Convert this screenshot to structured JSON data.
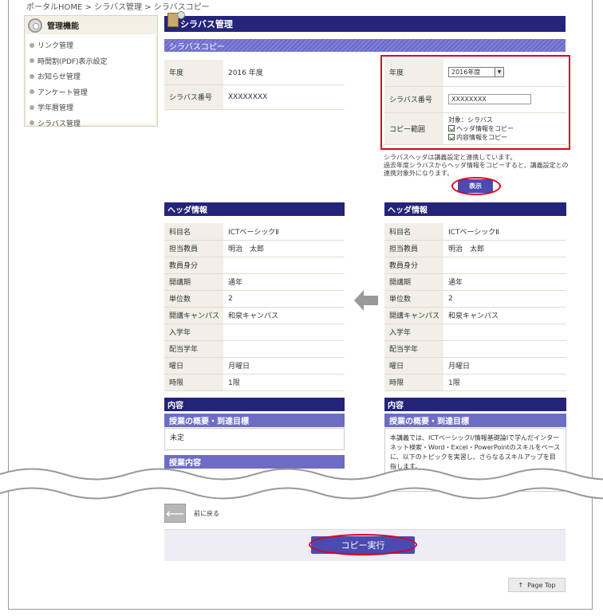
{
  "breadcrumb": {
    "home": "ポータルHOME",
    "sep1": " > ",
    "level2": "シラバス管理",
    "sep2": " > ",
    "current": "シラバスコピー"
  },
  "sidebar": {
    "title": "管理機能",
    "items": [
      {
        "label": "リンク管理"
      },
      {
        "label": "時間割(PDF)表示設定"
      },
      {
        "label": "お知らせ管理"
      },
      {
        "label": "アンケート管理"
      },
      {
        "label": "学年暦管理"
      },
      {
        "label": "シラバス管理"
      }
    ]
  },
  "page": {
    "title": "シラバス管理",
    "subtitle": "シラバスコピー"
  },
  "source_form": {
    "year_label": "年度",
    "year_value": "2016 年度",
    "number_label": "シラバス番号",
    "number_value": "XXXXXXXX"
  },
  "target_form": {
    "year_label": "年度",
    "year_value": "2016年度",
    "number_label": "シラバス番号",
    "number_value": "XXXXXXXX",
    "range_label": "コピー範囲",
    "range_target": "対象：シラバス",
    "check1_label": "ヘッダ情報をコピー",
    "check2_label": "内容情報をコピー"
  },
  "note": {
    "line1": "シラバスヘッダは講義設定と連携しています。",
    "line2": "過去年度シラバスからヘッダ情報をコピーすると、講義設定との",
    "line3": "連携対象外になります。"
  },
  "show_button": "表示",
  "header_info": {
    "title": "ヘッダ情報",
    "left_rows": [
      {
        "k": "科目名",
        "v": "ICTベーシックⅡ"
      },
      {
        "k": "担当教員",
        "v": "明治　太郎"
      },
      {
        "k": "教員身分",
        "v": ""
      },
      {
        "k": "開講期",
        "v": "通年"
      },
      {
        "k": "単位数",
        "v": "2"
      },
      {
        "k": "開講キャンパス",
        "v": "和泉キャンパス"
      },
      {
        "k": "入学年",
        "v": ""
      },
      {
        "k": "配当学年",
        "v": ""
      },
      {
        "k": "曜日",
        "v": "月曜日"
      },
      {
        "k": "時限",
        "v": "1限"
      }
    ],
    "right_rows": [
      {
        "k": "科目名",
        "v": "ICTベーシックⅡ"
      },
      {
        "k": "担当教員",
        "v": "明治　太郎"
      },
      {
        "k": "教員身分",
        "v": ""
      },
      {
        "k": "開講期",
        "v": "通年"
      },
      {
        "k": "単位数",
        "v": "2"
      },
      {
        "k": "開講キャンパス",
        "v": "和泉キャンパス"
      },
      {
        "k": "入学年",
        "v": ""
      },
      {
        "k": "配当学年",
        "v": ""
      },
      {
        "k": "曜日",
        "v": "月曜日"
      },
      {
        "k": "時限",
        "v": "1限"
      }
    ]
  },
  "content": {
    "title": "内容",
    "overview_title": "授業の概要・到達目標",
    "left_overview": "未定",
    "left_next_title": "授業内容",
    "right_overview": "本講義では、ICTベーシックI/情報基礎論Iで学んだインターネット検索・Word・Excel・PowerPointのスキルをベースに、以下のトピックを実習し、さらなるスキルアップを目指します。"
  },
  "footer": {
    "back_label": "前に戻る",
    "copy_button": "コピー実行",
    "page_top": "Page Top"
  },
  "colors": {
    "navy": "#24247a",
    "accent_purple": "#4a4ab0",
    "highlight_red": "#e0001b"
  }
}
